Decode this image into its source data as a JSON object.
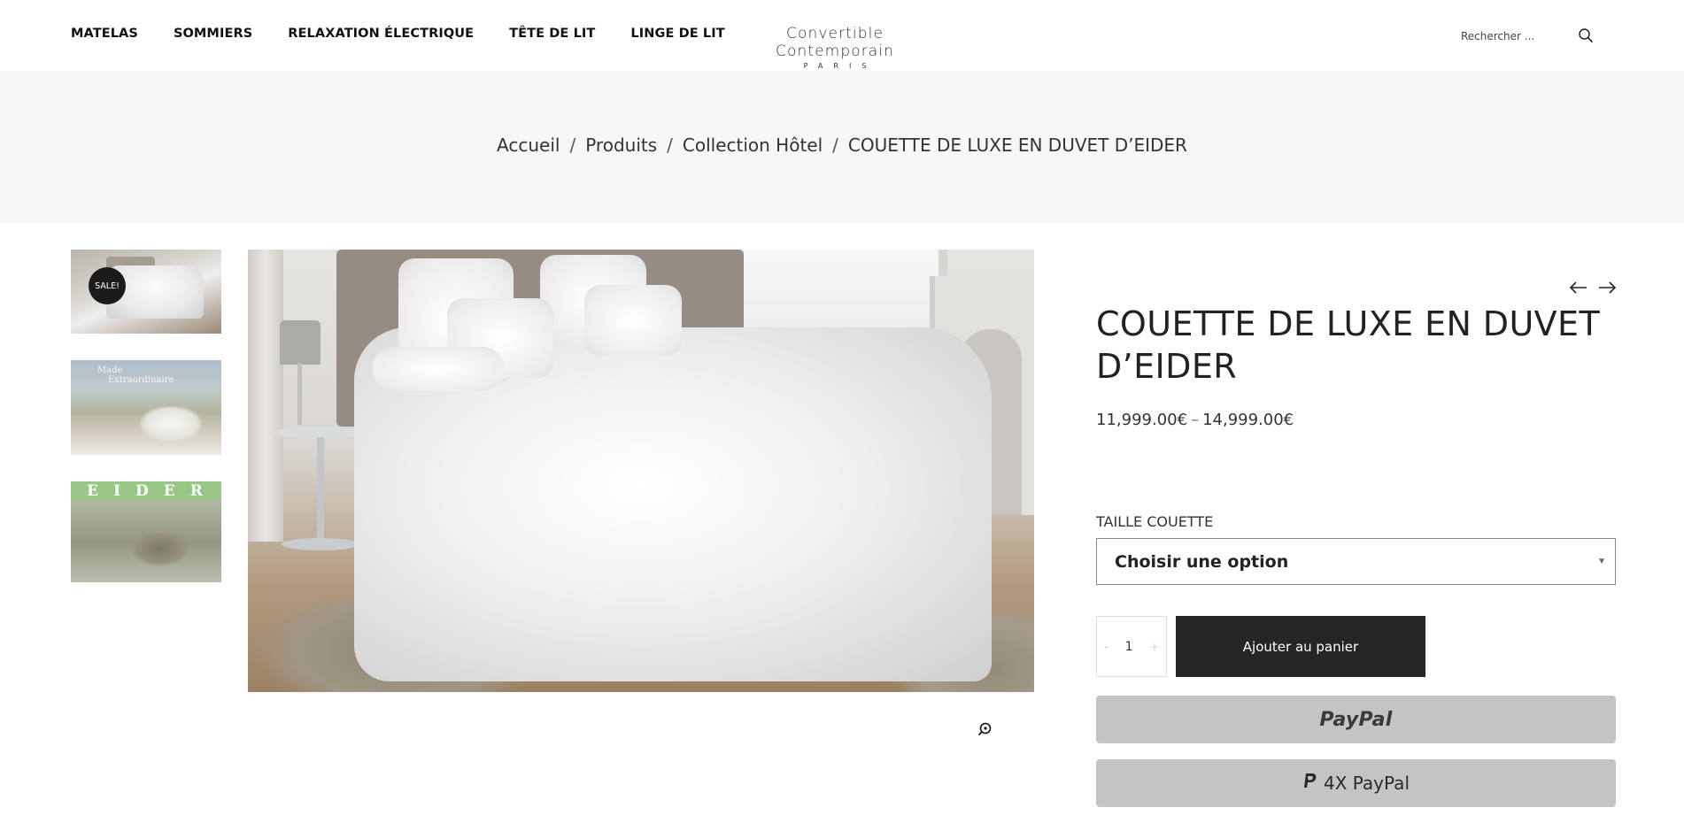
{
  "header": {
    "nav": [
      {
        "label": "MATELAS"
      },
      {
        "label": "SOMMIERS"
      },
      {
        "label": "RELAXATION ÉLECTRIQUE"
      },
      {
        "label": "TÊTE DE LIT"
      },
      {
        "label": "LINGE DE LIT"
      }
    ],
    "logo": {
      "main": "Convertible Contemporain",
      "sub": "PARIS"
    },
    "search": {
      "placeholder": "Rechercher ...",
      "icon": "search-icon"
    }
  },
  "breadcrumb": {
    "items": [
      "Accueil",
      "Produits",
      "Collection Hôtel"
    ],
    "current": "COUETTE DE LUXE EN DUVET D’EIDER",
    "separator": "/"
  },
  "gallery": {
    "sale_badge": "SALE!",
    "thumb2_text": [
      "Made",
      "Extraordinaire"
    ],
    "thumb3_title": "EIDER",
    "zoom_icon": "zoom-in-icon"
  },
  "product": {
    "title": "COUETTE DE LUXE EN DUVET D’EIDER",
    "price_min": "11,999.00€",
    "price_sep": "–",
    "price_max": "14,999.00€",
    "variant_label": "TAILLE COUETTE",
    "variant_value": "Choisir une option",
    "quantity": "1",
    "qty_minus": "-",
    "qty_plus": "+",
    "add_to_cart": "Ajouter au panier",
    "paypal_label": "PayPal",
    "paypal_4x_label": "4X PayPal",
    "prev_icon": "arrow-left-icon",
    "next_icon": "arrow-right-icon"
  },
  "colors": {
    "band_bg": "#f7f7f7",
    "button_dark": "#262626",
    "paypal_bg": "#c4c4c4",
    "sale_badge_bg": "#1b1b1b"
  }
}
